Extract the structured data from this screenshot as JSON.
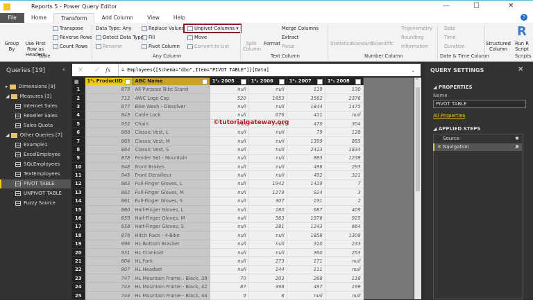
{
  "window": {
    "title": "Reports 5 - Power Query Editor",
    "minimize": "—",
    "maximize": "☐",
    "close": "✕",
    "help": "?"
  },
  "tabs": [
    "File",
    "Home",
    "Transform",
    "Add Column",
    "View",
    "Help"
  ],
  "ribbon": {
    "table": {
      "group_by": "Group By",
      "use_first_row": "Use First Row as Headers",
      "transpose": "Transpose",
      "reverse_rows": "Reverse Rows",
      "count_rows": "Count Rows",
      "label": "Table"
    },
    "any_column": {
      "data_type": "Data Type: Any",
      "detect": "Detect Data Type",
      "rename": "Rename",
      "replace": "Replace Values",
      "fill": "Fill",
      "pivot": "Pivot Column",
      "unpivot": "Unpivot Columns",
      "move": "Move",
      "convert": "Convert to List",
      "label": "Any Column"
    },
    "text_column": {
      "split": "Split Column",
      "format": "Format",
      "merge": "Merge Columns",
      "extract": "Extract",
      "parse": "Parse",
      "label": "Text Column"
    },
    "number_column": {
      "statistics": "Statistics",
      "standard": "Standard",
      "scientific": "Scientific",
      "trig": "Trigonometry",
      "rounding": "Rounding",
      "information": "Information",
      "label": "Number Column"
    },
    "datetime": {
      "date": "Date",
      "time": "Time",
      "duration": "Duration",
      "label": "Date & Time Column"
    },
    "structured": {
      "label": "Structured Column"
    },
    "scripts": {
      "run_r": "Run R Script",
      "label": "Scripts"
    }
  },
  "queries": {
    "title": "Queries [19]",
    "items": [
      {
        "label": "Dimensions [9]",
        "type": "folder"
      },
      {
        "label": "Measures [3]",
        "type": "folder"
      },
      {
        "label": "Internet Sales",
        "type": "table"
      },
      {
        "label": "Reseller Sales",
        "type": "table"
      },
      {
        "label": "Sales Quota",
        "type": "table"
      },
      {
        "label": "Other Queries [7]",
        "type": "folder"
      },
      {
        "label": "Example1",
        "type": "table"
      },
      {
        "label": "ExcelEmployee",
        "type": "table"
      },
      {
        "label": "SQLEmployees",
        "type": "table"
      },
      {
        "label": "TextEmployees",
        "type": "table"
      },
      {
        "label": "PIVOT TABLE",
        "type": "table",
        "selected": true
      },
      {
        "label": "UNPIVOT TABLE",
        "type": "table"
      },
      {
        "label": "Fuzzy Source",
        "type": "table"
      }
    ]
  },
  "formula": "= Employees{[Schema=\"dbo\",Item=\"PIVOT TABLE\"]}[Data]",
  "grid": {
    "columns": [
      "ProductID",
      "Name",
      "2005",
      "2006",
      "2007",
      "2008"
    ],
    "rows": [
      [
        "879",
        "All-Purpose Bike Stand",
        "null",
        "null",
        "119",
        "130"
      ],
      [
        "712",
        "AWC Logo Cap",
        "520",
        "1853",
        "3562",
        "2376"
      ],
      [
        "877",
        "Bike Wash - Dissolver",
        "null",
        "null",
        "1844",
        "1475"
      ],
      [
        "843",
        "Cable Lock",
        "null",
        "676",
        "411",
        "null"
      ],
      [
        "952",
        "Chain",
        "null",
        "null",
        "470",
        "304"
      ],
      [
        "866",
        "Classic Vest, L",
        "null",
        "null",
        "79",
        "128"
      ],
      [
        "865",
        "Classic Vest, M",
        "null",
        "null",
        "1399",
        "885"
      ],
      [
        "864",
        "Classic Vest, S",
        "null",
        "null",
        "2413",
        "1834"
      ],
      [
        "878",
        "Fender Set - Mountain",
        "null",
        "null",
        "883",
        "1238"
      ],
      [
        "948",
        "Front Brakes",
        "null",
        "null",
        "496",
        "293"
      ],
      [
        "945",
        "Front Derailleur",
        "null",
        "null",
        "492",
        "321"
      ],
      [
        "863",
        "Full-Finger Gloves, L",
        "null",
        "1942",
        "1429",
        "7"
      ],
      [
        "862",
        "Full-Finger Gloves, M",
        "null",
        "1279",
        "924",
        "3"
      ],
      [
        "861",
        "Full-Finger Gloves, S",
        "null",
        "307",
        "191",
        "2"
      ],
      [
        "860",
        "Half-Finger Gloves, L",
        "null",
        "180",
        "687",
        "409"
      ],
      [
        "859",
        "Half-Finger Gloves, M",
        "null",
        "563",
        "1976",
        "925"
      ],
      [
        "858",
        "Half-Finger Gloves, S",
        "null",
        "281",
        "1243",
        "664"
      ],
      [
        "876",
        "Hitch Rack - 4-Bike",
        "null",
        "null",
        "1858",
        "1308"
      ],
      [
        "996",
        "HL Bottom Bracket",
        "null",
        "null",
        "310",
        "233"
      ],
      [
        "951",
        "HL Crankset",
        "null",
        "null",
        "360",
        "253"
      ],
      [
        "804",
        "HL Fork",
        "null",
        "273",
        "171",
        "null"
      ],
      [
        "807",
        "HL Headset",
        "null",
        "144",
        "111",
        "null"
      ],
      [
        "747",
        "HL Mountain Frame - Black, 38",
        "70",
        "203",
        "268",
        "118"
      ],
      [
        "743",
        "HL Mountain Frame - Black, 42",
        "87",
        "398",
        "497",
        "199"
      ],
      [
        "744",
        "HL Mountain Frame - Black, 44",
        "9",
        "8",
        "null",
        "null"
      ]
    ]
  },
  "watermark": "©tutorialgateway.org",
  "settings": {
    "title": "QUERY SETTINGS",
    "properties": "PROPERTIES",
    "name_label": "Name",
    "name_value": "PIVOT TABLE",
    "all_properties": "All Properties",
    "applied_steps": "APPLIED STEPS",
    "steps": [
      "Source",
      "Navigation"
    ]
  }
}
